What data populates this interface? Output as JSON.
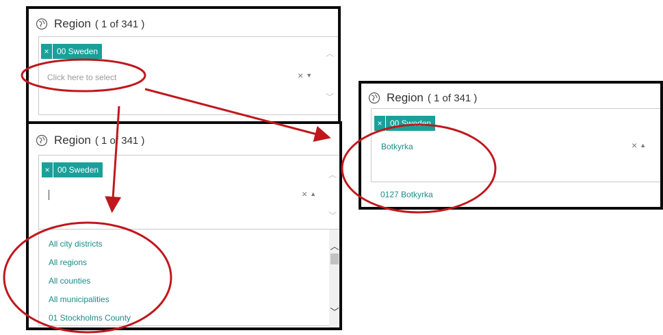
{
  "region_label": "Region",
  "region_count": "( 1 of 341 )",
  "selected_chip": "00 Sweden",
  "chip_remove_symbol": "×",
  "placeholder": "Click here to select",
  "clear_symbol": "×",
  "dropdown_down_symbol": "▼",
  "dropdown_up_symbol": "▲",
  "search_typed": "Botkyrka",
  "options": [
    "All city districts",
    "All regions",
    "All counties",
    "All municipalities",
    "01 Stockholms County"
  ],
  "search_result": "0127 Botkyrka",
  "accent_color": "#1aa09a",
  "annotation_color": "#c0171c"
}
